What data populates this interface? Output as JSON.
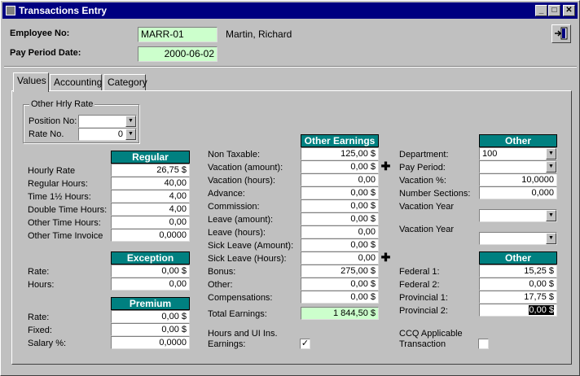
{
  "window": {
    "title": "Transactions Entry",
    "min": "_",
    "max": "□",
    "close": "✕"
  },
  "header": {
    "employee_no_label": "Employee No:",
    "employee_no_value": "MARR-01",
    "employee_name": "Martin, Richard",
    "pay_period_label": "Pay Period Date:",
    "pay_period_value": "2000-06-02"
  },
  "tabs": [
    "Values",
    "Accounting",
    "Category"
  ],
  "other_hrly": {
    "title": "Other Hrly Rate",
    "position_label": "Position No:",
    "position_value": "",
    "rate_label": "Rate No.",
    "rate_value": "0"
  },
  "regular": {
    "header": "Regular",
    "rows": [
      {
        "label": "Hourly Rate",
        "value": "26,75 $"
      },
      {
        "label": "Regular Hours:",
        "value": "40,00"
      },
      {
        "label": "Time 1½ Hours:",
        "value": "4,00"
      },
      {
        "label": "Double Time Hours:",
        "value": "4,00"
      },
      {
        "label": "Other Time Hours:",
        "value": "0,00"
      },
      {
        "label": "Other Time Invoice",
        "value": "0,0000"
      }
    ]
  },
  "exception": {
    "header": "Exception",
    "rows": [
      {
        "label": "Rate:",
        "value": "0,00 $"
      },
      {
        "label": "Hours:",
        "value": "0,00"
      }
    ]
  },
  "premium": {
    "header": "Premium",
    "rows": [
      {
        "label": "Rate:",
        "value": "0,00 $"
      },
      {
        "label": "Fixed:",
        "value": "0,00 $"
      },
      {
        "label": "Salary %:",
        "value": "0,0000"
      }
    ]
  },
  "other_earnings": {
    "header": "Other Earnings",
    "rows": [
      {
        "label": "Non Taxable:",
        "value": "125,00 $"
      },
      {
        "label": "Vacation (amount):",
        "value": "0,00 $"
      },
      {
        "label": "Vacation (hours):",
        "value": "0,00"
      },
      {
        "label": "Advance:",
        "value": "0,00 $"
      },
      {
        "label": "Commission:",
        "value": "0,00 $"
      },
      {
        "label": "Leave (amount):",
        "value": "0,00 $"
      },
      {
        "label": "Leave (hours):",
        "value": "0,00"
      },
      {
        "label": "Sick Leave (Amount):",
        "value": "0,00 $"
      },
      {
        "label": "Sick Leave (Hours):",
        "value": "0,00"
      },
      {
        "label": "Bonus:",
        "value": "275,00 $"
      },
      {
        "label": "Other:",
        "value": "0,00 $"
      },
      {
        "label": "Compensations:",
        "value": "0,00 $"
      }
    ],
    "total_label": "Total Earnings:",
    "total_value": "1 844,50 $",
    "hours_ui_label_1": "Hours and UI Ins.",
    "hours_ui_label_2": "Earnings:",
    "hours_ui_checked": "✓"
  },
  "other": {
    "header": "Other",
    "department_label": "Department:",
    "department_value": "100",
    "pay_period_label": "Pay Period:",
    "pay_period_value": "",
    "vacation_pct_label": "Vacation %:",
    "vacation_pct_value": "10,0000",
    "number_sections_label": "Number Sections:",
    "number_sections_value": "0,000",
    "vacation_year_label_1": "Vacation Year",
    "vacation_year_value_1": "",
    "vacation_year_label_2": "Vacation Year",
    "vacation_year_value_2": ""
  },
  "taxes": {
    "header": "Other",
    "rows": [
      {
        "label": "Federal 1:",
        "value": "15,25 $"
      },
      {
        "label": "Federal 2:",
        "value": "0,00 $"
      },
      {
        "label": "Provincial 1:",
        "value": "17,75 $"
      },
      {
        "label": "Provincial 2:",
        "value": "0,00 $"
      }
    ],
    "ccq_label_1": "CCQ Applicable",
    "ccq_label_2": "Transaction",
    "ccq_checked": ""
  }
}
